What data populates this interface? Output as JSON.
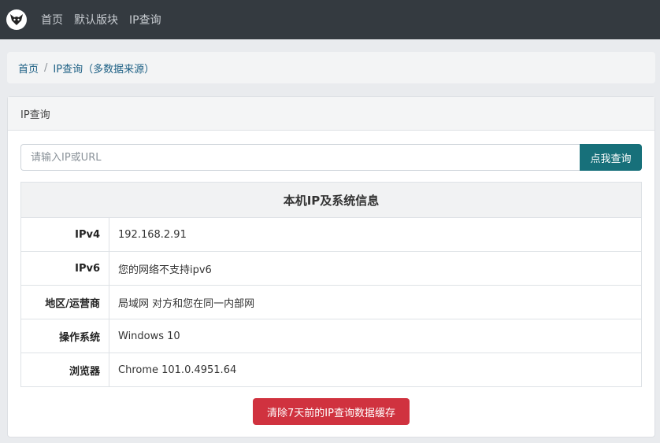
{
  "nav": {
    "logo_icon": "wolf-logo-icon",
    "items": [
      "首页",
      "默认版块",
      "IP查询"
    ]
  },
  "breadcrumb": {
    "home": "首页",
    "separator": "/",
    "current": "IP查询（多数据来源）"
  },
  "card": {
    "header": "IP查询",
    "search": {
      "placeholder": "请输入IP或URL",
      "value": "",
      "button_label": "点我查询"
    },
    "table": {
      "title": "本机IP及系统信息",
      "rows": [
        {
          "key": "IPv4",
          "value": "192.168.2.91"
        },
        {
          "key": "IPv6",
          "value": "您的网络不支持ipv6"
        },
        {
          "key": "地区/运营商",
          "value": "局域网 对方和您在同一内部网"
        },
        {
          "key": "操作系统",
          "value": "Windows 10"
        },
        {
          "key": "浏览器",
          "value": "Chrome 101.0.4951.64"
        }
      ]
    },
    "clear_button_label": "清除7天前的IP查询数据缓存"
  },
  "colors": {
    "navbar": "#343a40",
    "search_button": "#17707a",
    "clear_button": "#d0323f",
    "link": "#1c5f84"
  }
}
